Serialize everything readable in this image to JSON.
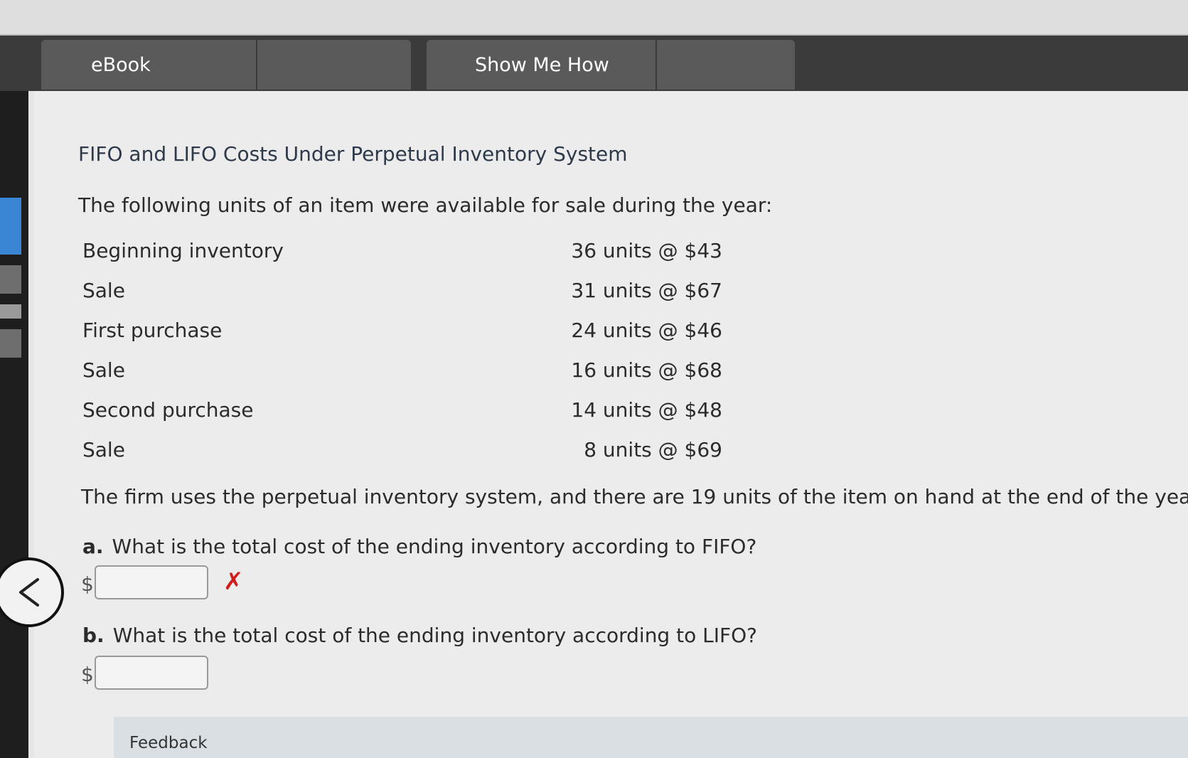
{
  "toolbar": {
    "ebook_label": "eBook",
    "show_me_how_label": "Show Me How"
  },
  "problem": {
    "title": "FIFO and LIFO Costs Under Perpetual Inventory System",
    "intro": "The following units of an item were available for sale during the year:",
    "rows": [
      {
        "label": "Beginning inventory",
        "value": "36 units @ $43"
      },
      {
        "label": "Sale",
        "value": "31 units @ $67"
      },
      {
        "label": "First purchase",
        "value": "24 units @ $46"
      },
      {
        "label": "Sale",
        "value": "16 units @ $68"
      },
      {
        "label": "Second purchase",
        "value": "14 units @ $48"
      },
      {
        "label": "Sale",
        "value": "8 units @ $69"
      }
    ],
    "statement": "The firm uses the perpetual inventory system, and there are 19 units of the item on hand at the end of the year."
  },
  "questions": {
    "a": {
      "letter": "a.",
      "text": "What is the total cost of the ending inventory according to FIFO?",
      "currency": "$",
      "value": "",
      "status_mark": "✗"
    },
    "b": {
      "letter": "b.",
      "text": "What is the total cost of the ending inventory according to LIFO?",
      "currency": "$",
      "value": ""
    }
  },
  "feedback": {
    "label": "Feedback"
  },
  "icons": {
    "back": "chevron-left-icon",
    "incorrect": "x-mark-icon"
  },
  "colors": {
    "incorrect": "#d21d1d",
    "toolbar": "#3b3b3b"
  }
}
